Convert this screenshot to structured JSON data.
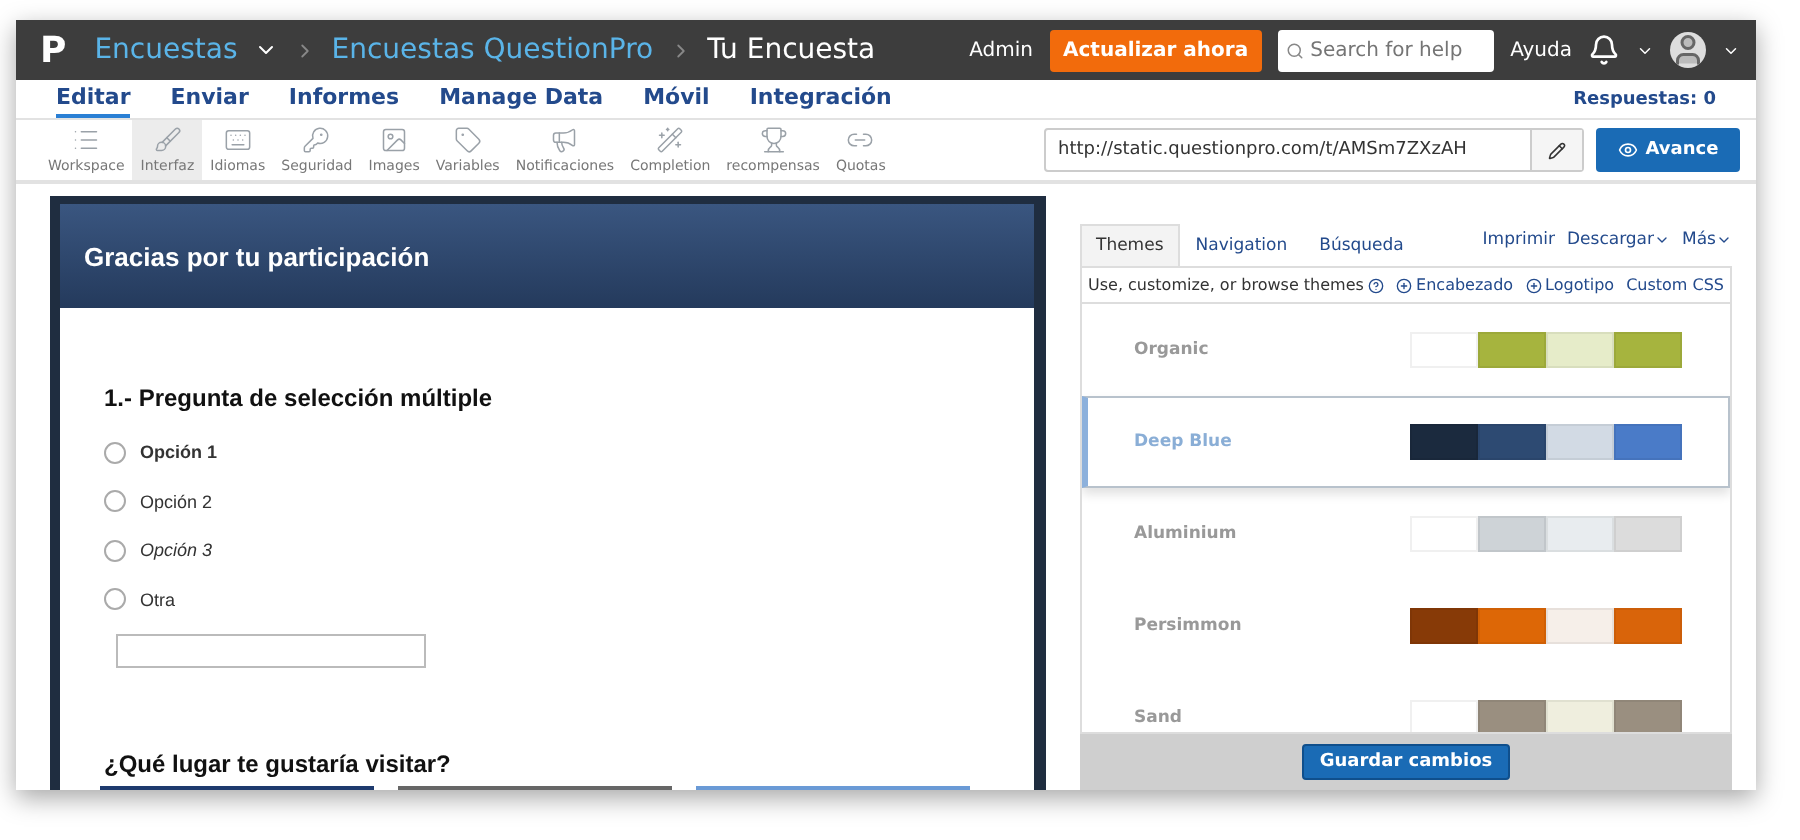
{
  "topbar": {
    "logo": "P",
    "product": "Encuestas",
    "breadcrumbs": [
      "Encuestas QuestionPro",
      "Tu Encuesta"
    ],
    "admin": "Admin",
    "upgrade": "Actualizar ahora",
    "search": {
      "placeholder": "Search for help"
    },
    "help": "Ayuda"
  },
  "nav": {
    "tabs": [
      {
        "label": "Editar",
        "selected": true
      },
      {
        "label": "Enviar",
        "selected": false
      },
      {
        "label": "Informes",
        "selected": false
      },
      {
        "label": "Manage Data",
        "selected": false
      },
      {
        "label": "Móvil",
        "selected": false
      },
      {
        "label": "Integración",
        "selected": false
      }
    ],
    "responses": "Respuestas: 0"
  },
  "toolbar": {
    "tools": [
      {
        "kind": "list",
        "label": "Workspace",
        "selected": false
      },
      {
        "kind": "brush",
        "label": "Interfaz",
        "selected": true
      },
      {
        "kind": "keyboard",
        "label": "Idiomas",
        "selected": false
      },
      {
        "kind": "key",
        "label": "Seguridad",
        "selected": false
      },
      {
        "kind": "image",
        "label": "Images",
        "selected": false
      },
      {
        "kind": "tag",
        "label": "Variables",
        "selected": false
      },
      {
        "kind": "megaphone",
        "label": "Notificaciones",
        "selected": false
      },
      {
        "kind": "wand",
        "label": "Completion",
        "selected": false
      },
      {
        "kind": "trophy",
        "label": "recompensas",
        "selected": false
      },
      {
        "kind": "link",
        "label": "Quotas",
        "selected": false
      }
    ],
    "url": "http://static.questionpro.com/t/AMSm7ZXzAH",
    "preview": "Avance"
  },
  "survey": {
    "header": "Gracias por tu participación",
    "question": "1.- Pregunta de selección múltiple",
    "options": [
      {
        "label": "Opción 1",
        "selected": false
      },
      {
        "label": "Opción 2",
        "selected": false
      },
      {
        "label": "Opción 3",
        "selected": false
      },
      {
        "label": "Otra",
        "selected": false
      }
    ],
    "question_2": "¿Qué lugar te gustaría visitar?"
  },
  "panel": {
    "tabs": [
      {
        "label": "Themes",
        "selected": true
      },
      {
        "label": "Navigation",
        "selected": false
      },
      {
        "label": "Búsqueda",
        "selected": false
      }
    ],
    "actions": [
      "Imprimir",
      "Descargar",
      "Más"
    ],
    "hint": "Use, customize, or browse themes",
    "links": [
      "Encabezado",
      "Logotipo",
      "Custom CSS"
    ],
    "themes": [
      {
        "name": "Organic",
        "selected": false,
        "swatches": [
          {
            "color": "#ffffff"
          },
          {
            "color": "#a6b43e"
          },
          {
            "color": "#e6ecc9"
          },
          {
            "color": "#a6b43e"
          }
        ]
      },
      {
        "name": "Deep Blue",
        "selected": true,
        "swatches": [
          {
            "color": "#1b2a3e"
          },
          {
            "color": "#2d4a72"
          },
          {
            "color": "#d2dae4"
          },
          {
            "color": "#4a7bc8"
          }
        ]
      },
      {
        "name": "Aluminium",
        "selected": false,
        "swatches": [
          {
            "color": "#ffffff"
          },
          {
            "color": "#ced3d7"
          },
          {
            "color": "#e8ecef"
          },
          {
            "color": "#dcdcdc"
          }
        ]
      },
      {
        "name": "Persimmon",
        "selected": false,
        "swatches": [
          {
            "color": "#873a07"
          },
          {
            "color": "#dd6706"
          },
          {
            "color": "#f6efe9"
          },
          {
            "color": "#d9640a"
          }
        ]
      },
      {
        "name": "Sand",
        "selected": false,
        "swatches": [
          {
            "color": "#ffffff"
          },
          {
            "color": "#9a8f80"
          },
          {
            "color": "#efeede"
          },
          {
            "color": "#9a8f80"
          }
        ]
      }
    ],
    "save": "Guardar cambios"
  }
}
